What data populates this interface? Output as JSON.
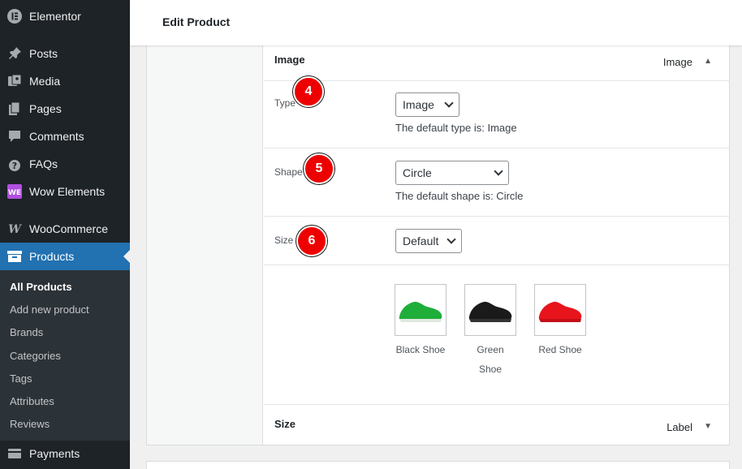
{
  "sidebar": {
    "items": [
      {
        "label": "Elementor",
        "icon": "elementor-icon"
      },
      {
        "label": "Posts",
        "icon": "pin-icon"
      },
      {
        "label": "Media",
        "icon": "media-icon"
      },
      {
        "label": "Pages",
        "icon": "pages-icon"
      },
      {
        "label": "Comments",
        "icon": "comment-icon"
      },
      {
        "label": "FAQs",
        "icon": "question-icon"
      },
      {
        "label": "Wow Elements",
        "icon": "wow-elements-icon"
      },
      {
        "label": "WooCommerce",
        "icon": "woocommerce-icon"
      },
      {
        "label": "Products",
        "icon": "archive-icon"
      },
      {
        "label": "Payments",
        "icon": "payments-icon"
      }
    ],
    "submenu": [
      "All Products",
      "Add new product",
      "Brands",
      "Categories",
      "Tags",
      "Attributes",
      "Reviews"
    ]
  },
  "header": {
    "title": "Edit Product"
  },
  "panel": {
    "image_section": {
      "title": "Image",
      "right_label": "Image"
    },
    "type": {
      "label": "Type",
      "value": "Image",
      "desc": "The default type is: Image",
      "badge": "4"
    },
    "shape": {
      "label": "Shape",
      "value": "Circle",
      "desc": "The default shape is: Circle",
      "badge": "5"
    },
    "size": {
      "label": "Size",
      "value": "Default",
      "badge": "6"
    },
    "swatches": [
      {
        "label": "Black Shoe",
        "color": "#1fae3a"
      },
      {
        "label": "Green Shoe",
        "color": "#1a1a1a"
      },
      {
        "label": "Red Shoe",
        "color": "#e8141c"
      }
    ],
    "size_section": {
      "title": "Size",
      "right_label": "Label"
    }
  },
  "colors": {
    "sidebar_bg": "#1d2327",
    "active": "#2271b1",
    "badge": "#ee0000"
  }
}
